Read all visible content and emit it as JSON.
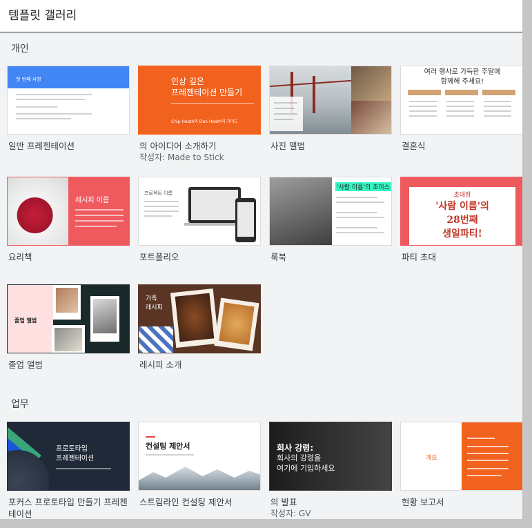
{
  "header": {
    "title": "템플릿 갤러리"
  },
  "sections": {
    "personal": {
      "title": "개인"
    },
    "work": {
      "title": "업무"
    }
  },
  "cards": {
    "general": {
      "label": "일반 프레젠테이션",
      "thumb_text": "첫 번째 사항"
    },
    "idea": {
      "label": "의 아이디어 소개하기",
      "sub": "작성자: Made to Stick",
      "thumb_title": "인상 깊은\n프레젠테이션 만들기",
      "thumb_sub": "Chip Heath와 Dan Heath의 가이드"
    },
    "photo": {
      "label": "사진 앨범"
    },
    "wedding": {
      "label": "결혼식",
      "thumb_title": "여러 행사로 가득한 주말에\n함께해 주세요!"
    },
    "recipe": {
      "label": "요리책",
      "thumb_title": "레시피 이름"
    },
    "portfolio": {
      "label": "포트폴리오",
      "thumb_title": "프로젝트 이름"
    },
    "lookbook": {
      "label": "룩북",
      "thumb_title": "'사람 이름'의 초이스"
    },
    "party": {
      "label": "파티 초대",
      "thumb_small": "초대장",
      "thumb_title": "'사람 이름'의\n28번째\n생일파티!"
    },
    "graduation": {
      "label": "졸업 앨범",
      "thumb_title": "졸업 앨범"
    },
    "recipe_intro": {
      "label": "레시피 소개",
      "thumb_title": "가족\n레시피"
    },
    "prototype": {
      "label": "포커스 프로토타입 만들기 프레젠테이션",
      "thumb_title": "프로토타입\n프레젠테이션"
    },
    "consulting": {
      "label": "스트림라인 컨설팅 제안서",
      "thumb_title": "컨설팅 제안서"
    },
    "pitch": {
      "label": "의 발표",
      "sub": "작성자: GV",
      "thumb_title": "회사 강령:",
      "thumb_body": "회사의 강령을\n여기에 기입하세요"
    },
    "status": {
      "label": "현황 보고서",
      "thumb_title": "개요"
    }
  },
  "colors": {
    "accent_blue": "#4285f4",
    "orange": "#f2621f",
    "coral": "#ef5a5f",
    "dark_navy": "#1f2937"
  }
}
